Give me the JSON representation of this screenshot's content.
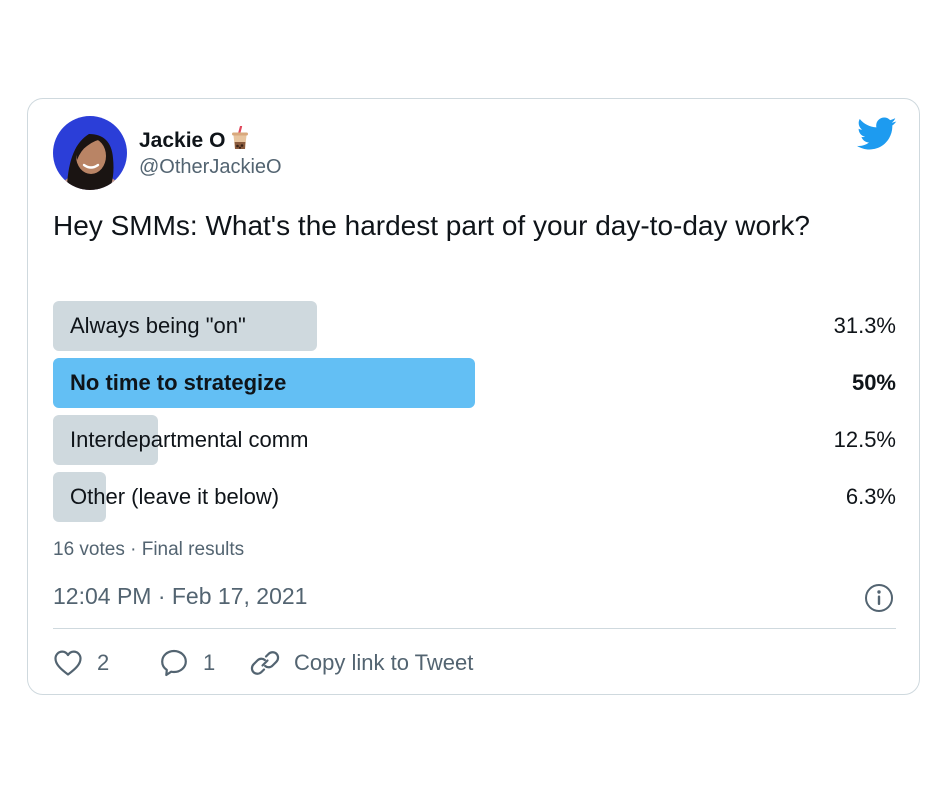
{
  "tweet": {
    "author": {
      "display_name": "Jackie O",
      "name_emoji": "bubble-tea-emoji",
      "handle": "@OtherJackieO",
      "avatar": "avatar-photo"
    },
    "brand_icon": "twitter-bird-icon",
    "text": "Hey SMMs: What's the hardest part of your day-to-day work?"
  },
  "poll": {
    "options": [
      {
        "label": "Always being \"on\"",
        "percent_text": "31.3%",
        "percent": 31.3,
        "winner": false
      },
      {
        "label": "No time to strategize",
        "percent_text": "50%",
        "percent": 50,
        "winner": true
      },
      {
        "label": "Interdepartmental comm",
        "percent_text": "12.5%",
        "percent": 12.5,
        "winner": false
      },
      {
        "label": "Other (leave it below)",
        "percent_text": "6.3%",
        "percent": 6.3,
        "winner": false
      }
    ],
    "meta": "16 votes · Final results"
  },
  "timestamp": "12:04 PM · Feb 17, 2021",
  "info_icon": "info-icon",
  "actions": {
    "like_count": "2",
    "reply_count": "1",
    "copy_link_label": "Copy link to Tweet"
  },
  "colors": {
    "winner_bar": "#63bff4",
    "option_bar": "#cfd9de",
    "twitter_blue": "#1d9bf0",
    "secondary_text": "#536471"
  }
}
